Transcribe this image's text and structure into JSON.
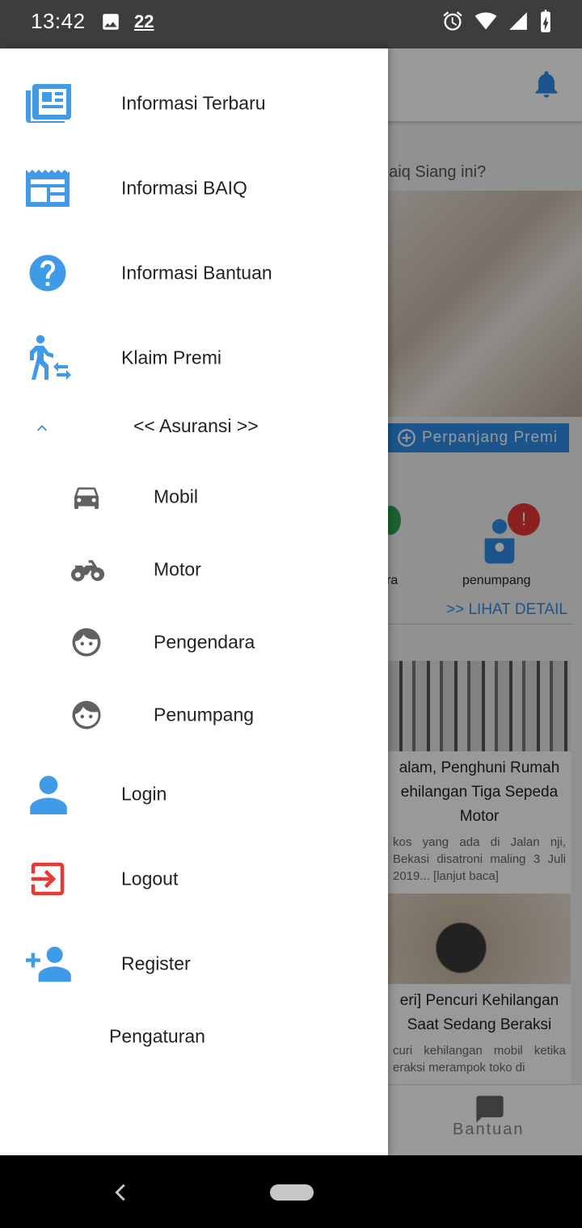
{
  "status_bar": {
    "time": "13:42",
    "notification_count": "22"
  },
  "background_app": {
    "greeting": "baiq Siang ini?",
    "perpanjang_button": "Perpanjang Premi",
    "partial_label_left": "ra",
    "penumpang_label": "penumpang",
    "alert_badge": "!",
    "lihat_detail": ">> LIHAT DETAIL",
    "news": [
      {
        "title": "alam, Penghuni Rumah ehilangan Tiga Sepeda Motor",
        "snippet": "kos yang ada di Jalan nji, Bekasi disatroni maling 3 Juli 2019... [lanjut baca]"
      },
      {
        "title": "eri] Pencuri Kehilangan Saat Sedang Beraksi",
        "snippet": "curi kehilangan mobil ketika eraksi merampok toko di"
      }
    ],
    "bottom_nav_label": "Bantuan"
  },
  "drawer": {
    "items": [
      {
        "label": "Informasi Terbaru",
        "icon": "newspaper-icon"
      },
      {
        "label": "Informasi BAIQ",
        "icon": "receipt-icon"
      },
      {
        "label": "Informasi Bantuan",
        "icon": "help-icon"
      },
      {
        "label": "Klaim Premi",
        "icon": "walk-transfer-icon"
      }
    ],
    "section": {
      "label": "<< Asuransi >>",
      "icon": "chevron-up-icon"
    },
    "sub_items": [
      {
        "label": "Mobil",
        "icon": "car-icon"
      },
      {
        "label": "Motor",
        "icon": "motorcycle-icon"
      },
      {
        "label": "Pengendara",
        "icon": "face-icon"
      },
      {
        "label": "Penumpang",
        "icon": "face-outline-icon"
      }
    ],
    "account_items": [
      {
        "label": "Login",
        "icon": "person-icon"
      },
      {
        "label": "Logout",
        "icon": "exit-icon"
      },
      {
        "label": "Register",
        "icon": "person-add-icon"
      }
    ],
    "settings_label": "Pengaturan"
  },
  "colors": {
    "accent": "#2d8ee8",
    "icon_blue": "#3f9ae8",
    "logout_red": "#e53935",
    "sub_icon_grey": "#616161"
  }
}
